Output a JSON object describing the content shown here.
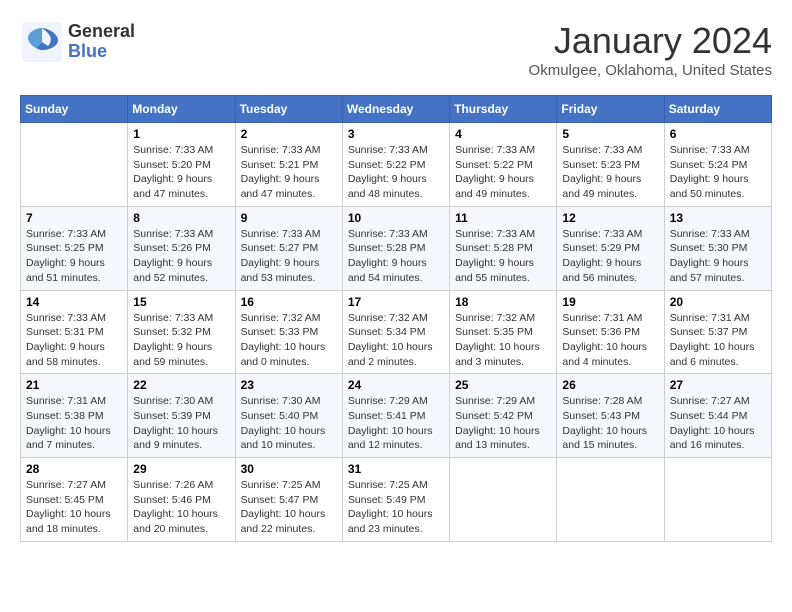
{
  "header": {
    "logo_general": "General",
    "logo_blue": "Blue",
    "month_year": "January 2024",
    "location": "Okmulgee, Oklahoma, United States"
  },
  "calendar": {
    "days_of_week": [
      "Sunday",
      "Monday",
      "Tuesday",
      "Wednesday",
      "Thursday",
      "Friday",
      "Saturday"
    ],
    "weeks": [
      [
        {
          "day": "",
          "info": ""
        },
        {
          "day": "1",
          "info": "Sunrise: 7:33 AM\nSunset: 5:20 PM\nDaylight: 9 hours\nand 47 minutes."
        },
        {
          "day": "2",
          "info": "Sunrise: 7:33 AM\nSunset: 5:21 PM\nDaylight: 9 hours\nand 47 minutes."
        },
        {
          "day": "3",
          "info": "Sunrise: 7:33 AM\nSunset: 5:22 PM\nDaylight: 9 hours\nand 48 minutes."
        },
        {
          "day": "4",
          "info": "Sunrise: 7:33 AM\nSunset: 5:22 PM\nDaylight: 9 hours\nand 49 minutes."
        },
        {
          "day": "5",
          "info": "Sunrise: 7:33 AM\nSunset: 5:23 PM\nDaylight: 9 hours\nand 49 minutes."
        },
        {
          "day": "6",
          "info": "Sunrise: 7:33 AM\nSunset: 5:24 PM\nDaylight: 9 hours\nand 50 minutes."
        }
      ],
      [
        {
          "day": "7",
          "info": "Sunrise: 7:33 AM\nSunset: 5:25 PM\nDaylight: 9 hours\nand 51 minutes."
        },
        {
          "day": "8",
          "info": "Sunrise: 7:33 AM\nSunset: 5:26 PM\nDaylight: 9 hours\nand 52 minutes."
        },
        {
          "day": "9",
          "info": "Sunrise: 7:33 AM\nSunset: 5:27 PM\nDaylight: 9 hours\nand 53 minutes."
        },
        {
          "day": "10",
          "info": "Sunrise: 7:33 AM\nSunset: 5:28 PM\nDaylight: 9 hours\nand 54 minutes."
        },
        {
          "day": "11",
          "info": "Sunrise: 7:33 AM\nSunset: 5:28 PM\nDaylight: 9 hours\nand 55 minutes."
        },
        {
          "day": "12",
          "info": "Sunrise: 7:33 AM\nSunset: 5:29 PM\nDaylight: 9 hours\nand 56 minutes."
        },
        {
          "day": "13",
          "info": "Sunrise: 7:33 AM\nSunset: 5:30 PM\nDaylight: 9 hours\nand 57 minutes."
        }
      ],
      [
        {
          "day": "14",
          "info": "Sunrise: 7:33 AM\nSunset: 5:31 PM\nDaylight: 9 hours\nand 58 minutes."
        },
        {
          "day": "15",
          "info": "Sunrise: 7:33 AM\nSunset: 5:32 PM\nDaylight: 9 hours\nand 59 minutes."
        },
        {
          "day": "16",
          "info": "Sunrise: 7:32 AM\nSunset: 5:33 PM\nDaylight: 10 hours\nand 0 minutes."
        },
        {
          "day": "17",
          "info": "Sunrise: 7:32 AM\nSunset: 5:34 PM\nDaylight: 10 hours\nand 2 minutes."
        },
        {
          "day": "18",
          "info": "Sunrise: 7:32 AM\nSunset: 5:35 PM\nDaylight: 10 hours\nand 3 minutes."
        },
        {
          "day": "19",
          "info": "Sunrise: 7:31 AM\nSunset: 5:36 PM\nDaylight: 10 hours\nand 4 minutes."
        },
        {
          "day": "20",
          "info": "Sunrise: 7:31 AM\nSunset: 5:37 PM\nDaylight: 10 hours\nand 6 minutes."
        }
      ],
      [
        {
          "day": "21",
          "info": "Sunrise: 7:31 AM\nSunset: 5:38 PM\nDaylight: 10 hours\nand 7 minutes."
        },
        {
          "day": "22",
          "info": "Sunrise: 7:30 AM\nSunset: 5:39 PM\nDaylight: 10 hours\nand 9 minutes."
        },
        {
          "day": "23",
          "info": "Sunrise: 7:30 AM\nSunset: 5:40 PM\nDaylight: 10 hours\nand 10 minutes."
        },
        {
          "day": "24",
          "info": "Sunrise: 7:29 AM\nSunset: 5:41 PM\nDaylight: 10 hours\nand 12 minutes."
        },
        {
          "day": "25",
          "info": "Sunrise: 7:29 AM\nSunset: 5:42 PM\nDaylight: 10 hours\nand 13 minutes."
        },
        {
          "day": "26",
          "info": "Sunrise: 7:28 AM\nSunset: 5:43 PM\nDaylight: 10 hours\nand 15 minutes."
        },
        {
          "day": "27",
          "info": "Sunrise: 7:27 AM\nSunset: 5:44 PM\nDaylight: 10 hours\nand 16 minutes."
        }
      ],
      [
        {
          "day": "28",
          "info": "Sunrise: 7:27 AM\nSunset: 5:45 PM\nDaylight: 10 hours\nand 18 minutes."
        },
        {
          "day": "29",
          "info": "Sunrise: 7:26 AM\nSunset: 5:46 PM\nDaylight: 10 hours\nand 20 minutes."
        },
        {
          "day": "30",
          "info": "Sunrise: 7:25 AM\nSunset: 5:47 PM\nDaylight: 10 hours\nand 22 minutes."
        },
        {
          "day": "31",
          "info": "Sunrise: 7:25 AM\nSunset: 5:49 PM\nDaylight: 10 hours\nand 23 minutes."
        },
        {
          "day": "",
          "info": ""
        },
        {
          "day": "",
          "info": ""
        },
        {
          "day": "",
          "info": ""
        }
      ]
    ]
  }
}
